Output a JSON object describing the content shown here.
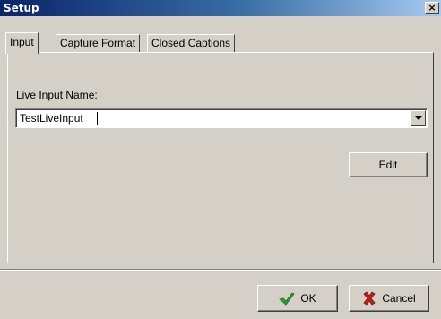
{
  "window": {
    "title": "Setup",
    "close_label": "×"
  },
  "tabs": [
    {
      "label": "Input",
      "active": true
    },
    {
      "label": "Capture Format",
      "active": false
    },
    {
      "label": "Closed Captions",
      "active": false
    }
  ],
  "input_tab": {
    "live_input_label": "Live Input Name:",
    "live_input_value": "TestLiveInput",
    "edit_button": "Edit"
  },
  "footer": {
    "ok_button": "OK",
    "cancel_button": "Cancel"
  },
  "icons": {
    "ok": "checkmark-icon",
    "cancel": "x-cross-icon",
    "dropdown": "chevron-down-icon",
    "close": "close-icon"
  },
  "colors": {
    "titlebar_start": "#0a246a",
    "titlebar_end": "#a6caf0",
    "dialog_bg": "#d4d0c8",
    "ok_icon": "#2e9e2e",
    "cancel_icon": "#c0201a"
  }
}
